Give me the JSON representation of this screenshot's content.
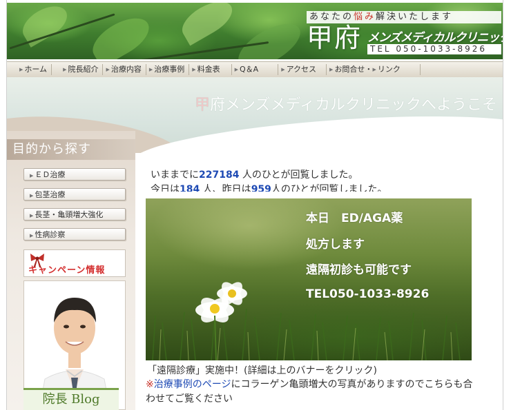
{
  "header": {
    "tagline_parts": [
      "あなたの",
      "悩み",
      "解決いたします"
    ],
    "logo_kanji": "甲府",
    "logo_name": "メンズメディカルクリニック",
    "phone": "TEL 050-1033-8926"
  },
  "nav": {
    "items": [
      "ホーム",
      "院長紹介",
      "治療内容",
      "治療事例",
      "料金表",
      "Q＆A",
      "アクセス",
      "お問合せ・",
      "リンク"
    ]
  },
  "welcome": {
    "first": "甲",
    "rest": "府メンズメディカルクリニックへようこそ"
  },
  "sidebar": {
    "heading": "目的から探す",
    "buttons": [
      "ＥＤ治療",
      "包茎治療",
      "長茎・亀頭増大強化",
      "性病診察"
    ],
    "campaign": "キャンペーン情報",
    "blog_label": "院長 Blog"
  },
  "counter": {
    "prefix": "いままでに",
    "total": "227184",
    "suffix": " 人のひとが回覧しました。",
    "today_prefix": "今日は",
    "today": "184",
    "mid": " 人、昨日は",
    "yesterday": "959",
    "tail": "人のひとが回覧しました。"
  },
  "promo": {
    "line1": "本日　ED/AGA薬",
    "line2": "処方します",
    "line3": "遠隔初診も可能です",
    "line4": "TEL050-1033-8926"
  },
  "caption": "「遠隔診療」実施中！(詳細は上のバナーをクリック)",
  "note": {
    "mark": "※",
    "link": "治療事例のページ",
    "text": "にコラーゲン亀頭増大の写真がありますのでこちらも合わせてご覧ください"
  },
  "colors": {
    "accent_blue": "#1e4ab4",
    "accent_red": "#c8342a",
    "banner_green": "#3f7d2e"
  }
}
